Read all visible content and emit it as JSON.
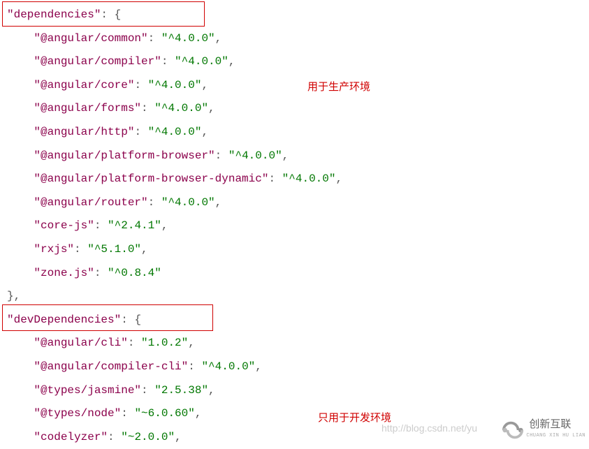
{
  "dep_header_key": "\"dependencies\"",
  "dep_header_punc": ": {",
  "deps": [
    {
      "k": "\"@angular/common\"",
      "p1": ": ",
      "v": "\"^4.0.0\"",
      "p2": ","
    },
    {
      "k": "\"@angular/compiler\"",
      "p1": ": ",
      "v": "\"^4.0.0\"",
      "p2": ","
    },
    {
      "k": "\"@angular/core\"",
      "p1": ": ",
      "v": "\"^4.0.0\"",
      "p2": ","
    },
    {
      "k": "\"@angular/forms\"",
      "p1": ": ",
      "v": "\"^4.0.0\"",
      "p2": ","
    },
    {
      "k": "\"@angular/http\"",
      "p1": ": ",
      "v": "\"^4.0.0\"",
      "p2": ","
    },
    {
      "k": "\"@angular/platform-browser\"",
      "p1": ": ",
      "v": "\"^4.0.0\"",
      "p2": ","
    },
    {
      "k": "\"@angular/platform-browser-dynamic\"",
      "p1": ": ",
      "v": "\"^4.0.0\"",
      "p2": ","
    },
    {
      "k": "\"@angular/router\"",
      "p1": ": ",
      "v": "\"^4.0.0\"",
      "p2": ","
    },
    {
      "k": "\"core-js\"",
      "p1": ": ",
      "v": "\"^2.4.1\"",
      "p2": ","
    },
    {
      "k": "\"rxjs\"",
      "p1": ": ",
      "v": "\"^5.1.0\"",
      "p2": ","
    },
    {
      "k": "\"zone.js\"",
      "p1": ": ",
      "v": "\"^0.8.4\"",
      "p2": ""
    }
  ],
  "dep_close": "},",
  "devdep_header_key": "\"devDependencies\"",
  "devdep_header_punc": ": {",
  "devdeps": [
    {
      "k": "\"@angular/cli\"",
      "p1": ": ",
      "v": "\"1.0.2\"",
      "p2": ","
    },
    {
      "k": "\"@angular/compiler-cli\"",
      "p1": ": ",
      "v": "\"^4.0.0\"",
      "p2": ","
    },
    {
      "k": "\"@types/jasmine\"",
      "p1": ": ",
      "v": "\"2.5.38\"",
      "p2": ","
    },
    {
      "k": "\"@types/node\"",
      "p1": ": ",
      "v": "\"~6.0.60\"",
      "p2": ","
    },
    {
      "k": "\"codelyzer\"",
      "p1": ": ",
      "v": "\"~2.0.0\"",
      "p2": ","
    }
  ],
  "annotation1": "用于生产环境",
  "annotation2": "只用于开发环境",
  "watermark_url": "http://blog.csdn.net/yu",
  "brand_cn": "创新互联",
  "brand_en": "CHUANG XIN HU LIAN"
}
